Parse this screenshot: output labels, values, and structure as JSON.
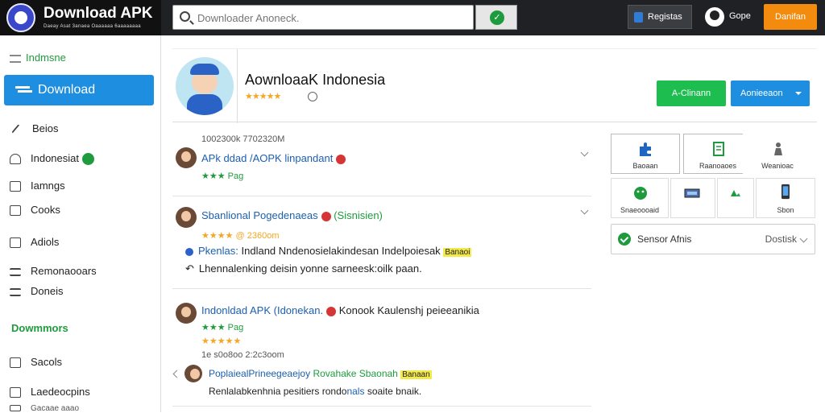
{
  "topbar": {
    "brand_title": "Download APK",
    "brand_subtitle": "Daeay Asat 3anaea Oaaaaaa 6aaaaaaaa",
    "search_placeholder": "Downloader Anoneck.",
    "search_button_glyph": "✓",
    "register_label": "Registas",
    "user_name": "Gope",
    "cta_label": "Danifan"
  },
  "sidebar": {
    "header": "Indmsne",
    "download_label": "Download",
    "items": [
      {
        "label": "Beios"
      },
      {
        "label": "Indonesiat"
      },
      {
        "label": "Iamngs"
      },
      {
        "label": "Cooks"
      },
      {
        "label": "Adiols"
      },
      {
        "label": "Remonaooars"
      },
      {
        "label": "Doneis"
      }
    ],
    "section_label": "Dowmmors",
    "items2": [
      {
        "label": "Sacols"
      },
      {
        "label": "Laedeocpins"
      },
      {
        "label": "Gacaae aaao"
      }
    ]
  },
  "app": {
    "title": "AownloaaK Indonesia",
    "rating_stars": "★★★★★",
    "btn_primary": "A-Clinann",
    "btn_secondary": "Aonieeaon"
  },
  "feed": [
    {
      "time": "1002300k 7702320M",
      "title": "APk ddad /AOPK linpandant",
      "tag": "★★★ Pag"
    },
    {
      "title": "Sbanlional Pogedenaeas",
      "title_suffix": "(Sisnisien)",
      "stars_meta": "★★★★ @ 2360om",
      "line1_prefix": "Pkenlas:",
      "line1": "Indland Nndenosielakindesan Indelpoiesak",
      "line1_badge": "Banaoi",
      "line2": "Lhennalenking deisin yonne sarneesk:oilk paan."
    },
    {
      "title": "Indonldad APK (Idonekan.",
      "title_suffix": "Konook Kaulenshj peieeanikia",
      "tag": "★★★ Pag",
      "stars": "★★★★★",
      "time": "1e s0o8oo 2:2c3oom",
      "reply_title": "PoplaiealPrineegeaejoy",
      "reply_suffix": "Rovahake Sbaonah",
      "reply_badge": "Banaan",
      "reply_line_a": "Renlalabkenhnia pesitiers rondo",
      "reply_line_b": "nals",
      "reply_line_c": "soaite bnaik."
    }
  ],
  "right_panel": {
    "tiles": [
      {
        "label": "Baoaan",
        "icon": "puzzle-icon"
      },
      {
        "label": "Raanoaoes",
        "icon": "document-icon"
      },
      {
        "label": "Weanioac",
        "icon": "figure-icon"
      },
      {
        "label": "Snaeoooaid",
        "icon": "android-icon"
      },
      {
        "label": "",
        "icon": "keyboard-icon"
      },
      {
        "label": "",
        "icon": "recycle-icon"
      },
      {
        "label": "Sbon",
        "icon": "phone-icon"
      }
    ],
    "status_label": "Sensor Afnis",
    "status_value": "Dostisk"
  },
  "colors": {
    "brand_green": "#1e9b3d",
    "brand_blue": "#1d8ee0",
    "cta_orange": "#f38b0f",
    "topbar_bg": "#202124"
  }
}
